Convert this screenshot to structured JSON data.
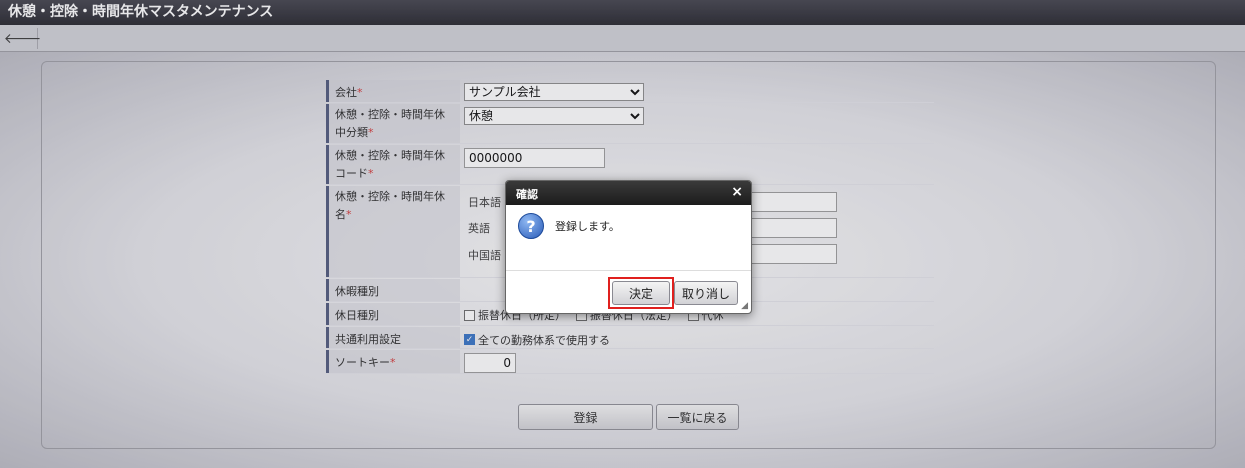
{
  "app": {
    "title": "休憩・控除・時間年休マスタメンテナンス"
  },
  "toolbar": {
    "back_icon": "arrow-left-icon",
    "back_glyph": "🡐"
  },
  "form": {
    "company": {
      "label": "会社",
      "required_mark": "*",
      "value": "サンプル会社"
    },
    "category": {
      "label": "休憩・控除・時間年休中分類",
      "required_mark": "*",
      "value": "休憩"
    },
    "code": {
      "label": "休憩・控除・時間年休コード",
      "required_mark": "*",
      "value": "0000000"
    },
    "name": {
      "label": "休憩・控除・時間年休名",
      "required_mark": "*",
      "languages": [
        {
          "label": "日本語",
          "value": ""
        },
        {
          "label": "英語",
          "value": ""
        },
        {
          "label": "中国語",
          "value": ""
        }
      ]
    },
    "leave_type": {
      "label": "休暇種別",
      "value": ""
    },
    "holiday_type": {
      "label": "休日種別",
      "options": [
        {
          "label": "振替休日（所定）",
          "checked": false
        },
        {
          "label": "振替休日（法定）",
          "checked": false
        },
        {
          "label": "代休",
          "checked": false
        }
      ]
    },
    "shared_setting": {
      "label": "共通利用設定",
      "option": {
        "label": "全ての勤務体系で使用する",
        "checked": true
      }
    },
    "sort_key": {
      "label": "ソートキー",
      "required_mark": "*",
      "value": "0"
    }
  },
  "actions": {
    "register_label": "登録",
    "back_to_list_label": "一覧に戻る"
  },
  "dialog": {
    "title": "確認",
    "close_glyph": "×",
    "message": "登録します。",
    "icon": "question-icon",
    "icon_glyph": "?",
    "ok_label": "決定",
    "cancel_label": "取り消し"
  }
}
